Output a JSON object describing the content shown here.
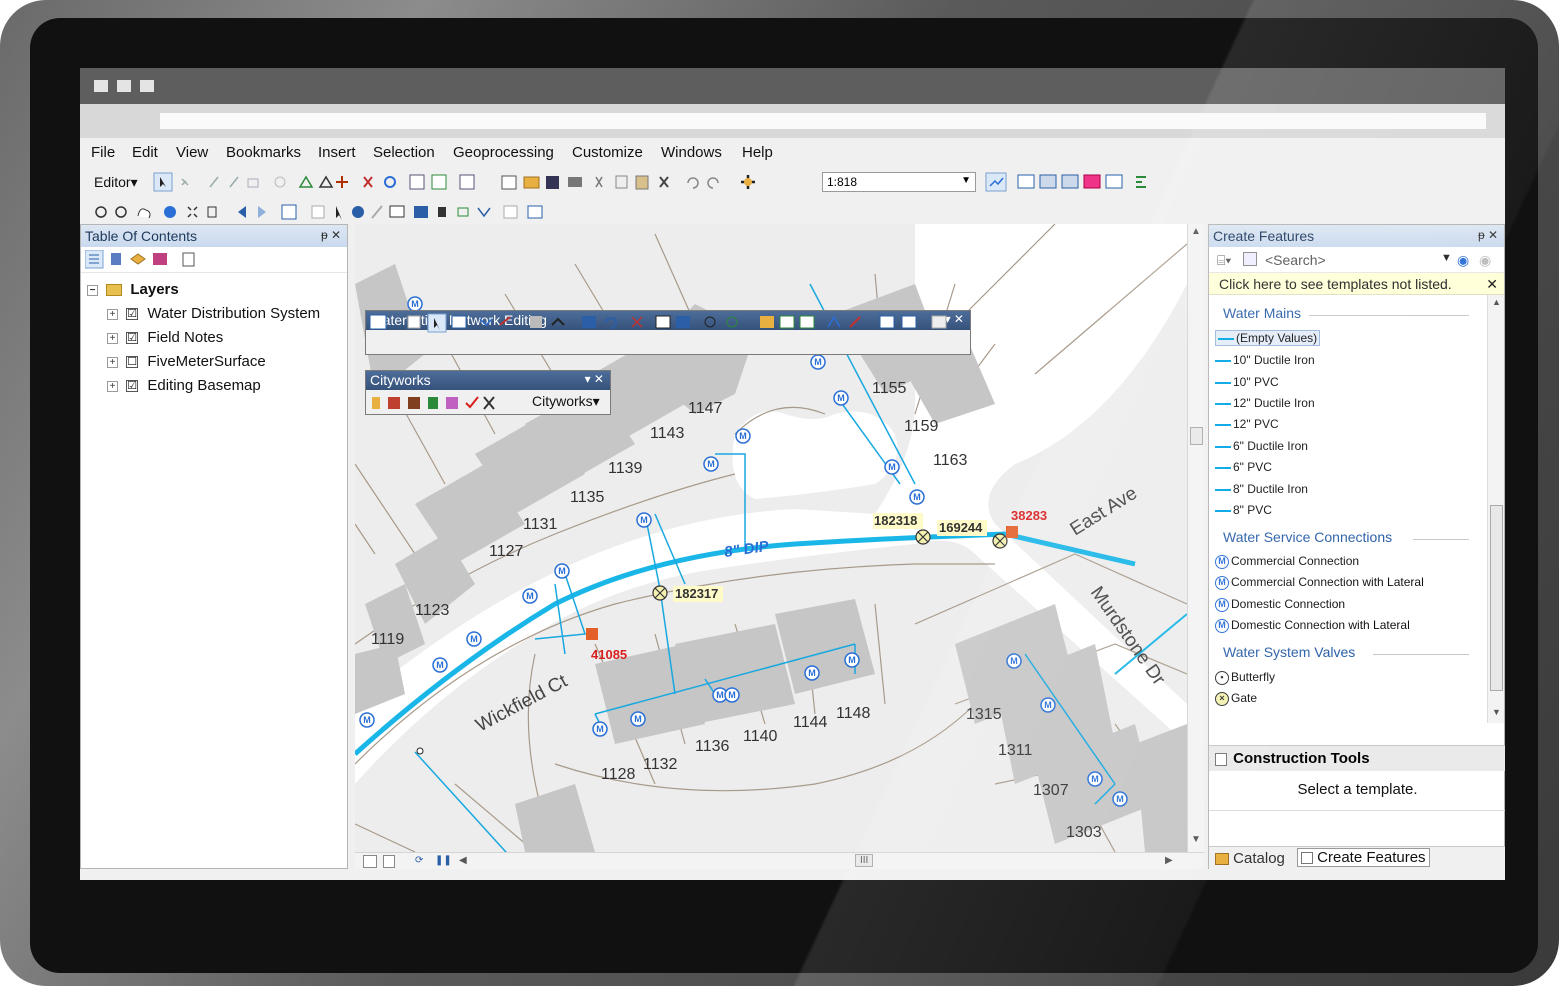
{
  "window": {
    "title_squares": 3
  },
  "menubar": [
    "File",
    "Edit",
    "View",
    "Bookmarks",
    "Insert",
    "Selection",
    "Geoprocessing",
    "Customize",
    "Windows",
    "Help"
  ],
  "toolbar": {
    "editor_label": "Editor▾",
    "scale": "1:818"
  },
  "toc": {
    "title": "Table Of Contents",
    "pin": "ᵽ ✕",
    "root": "Layers",
    "layers": [
      {
        "label": "Water Distribution System",
        "checked": "☑"
      },
      {
        "label": "Field Notes",
        "checked": "☑"
      },
      {
        "label": "FiveMeterSurface",
        "checked": "☐"
      },
      {
        "label": "Editing Basemap",
        "checked": "☑"
      }
    ]
  },
  "water_toolbar": {
    "title": "Water Utility Network Editing",
    "controls": "▾ ✕"
  },
  "cityworks_toolbar": {
    "title": "Cityworks",
    "controls": "▾ ✕",
    "menu": "Cityworks▾"
  },
  "map": {
    "parcels": [
      "1147",
      "1143",
      "1139",
      "1135",
      "1131",
      "1127",
      "1123",
      "1119",
      "1155",
      "1159",
      "1163",
      "1136",
      "1140",
      "1144",
      "1148",
      "1128",
      "1132",
      "1315",
      "1311",
      "1307",
      "1303"
    ],
    "streets": [
      "Wickfield Ct",
      "East Ave",
      "Murdstone Dr"
    ],
    "pipe_label": "8\" DIP",
    "valve_ids": [
      "182318",
      "169244",
      "182317"
    ],
    "red_ids": [
      "38283",
      "41085"
    ],
    "meter_symbol": "M",
    "hscroll_thumb": "III",
    "colors": {
      "pipe": "#1ab6e8",
      "service": "#18a8e0",
      "building": "#c6c6c6",
      "parcel_line": "#a89a8a",
      "road": "#ffffff",
      "red_label": "#d81e1e"
    }
  },
  "create_features": {
    "title": "Create Features",
    "pin": "ᵽ ✕",
    "search_placeholder": "<Search>",
    "notice": "Click here to see templates not listed.",
    "notice_close": "✕",
    "groups": [
      {
        "name": "Water Mains",
        "items": [
          "(Empty Values)",
          "10\" Ductile Iron",
          "10\" PVC",
          "12\" Ductile Iron",
          "12\" PVC",
          "6\" Ductile Iron",
          "6\" PVC",
          "8\" Ductile Iron",
          "8\" PVC"
        ]
      },
      {
        "name": "Water Service Connections",
        "items": [
          "Commercial Connection",
          "Commercial Connection with Lateral",
          "Domestic Connection",
          "Domestic Connection with Lateral"
        ]
      },
      {
        "name": "Water System Valves",
        "items": [
          "Butterfly",
          "Gate"
        ]
      }
    ],
    "construction_tools": {
      "title": "Construction Tools",
      "message": "Select a template."
    },
    "tabs": [
      "Catalog",
      "Create Features"
    ]
  }
}
